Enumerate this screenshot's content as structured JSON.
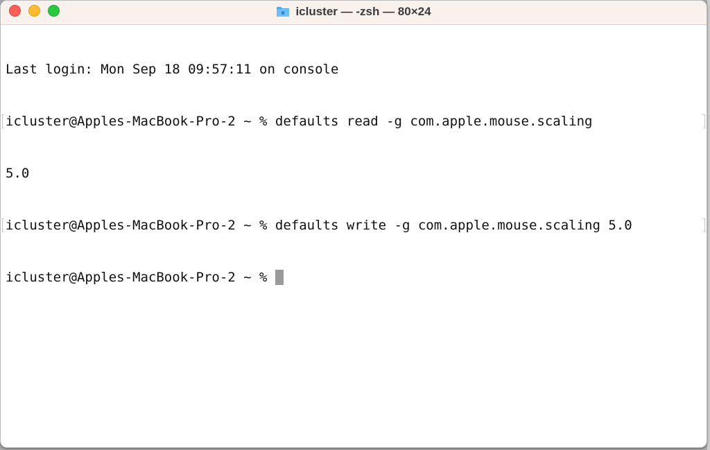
{
  "window": {
    "title": "icluster — -zsh — 80×24",
    "title_icon": "home-folder-icon",
    "traffic_lights": {
      "close": "#fe5f57",
      "minimize": "#febc2e",
      "zoom": "#28c840"
    }
  },
  "terminal": {
    "lines": [
      {
        "text": "Last login: Mon Sep 18 09:57:11 on console",
        "marked": false
      },
      {
        "text": "icluster@Apples-MacBook-Pro-2 ~ % defaults read -g com.apple.mouse.scaling",
        "marked": true
      },
      {
        "text": "5.0",
        "marked": false
      },
      {
        "text": "icluster@Apples-MacBook-Pro-2 ~ % defaults write -g com.apple.mouse.scaling 5.0",
        "marked": true
      },
      {
        "text": "icluster@Apples-MacBook-Pro-2 ~ % ",
        "marked": false,
        "cursor": true
      }
    ]
  }
}
